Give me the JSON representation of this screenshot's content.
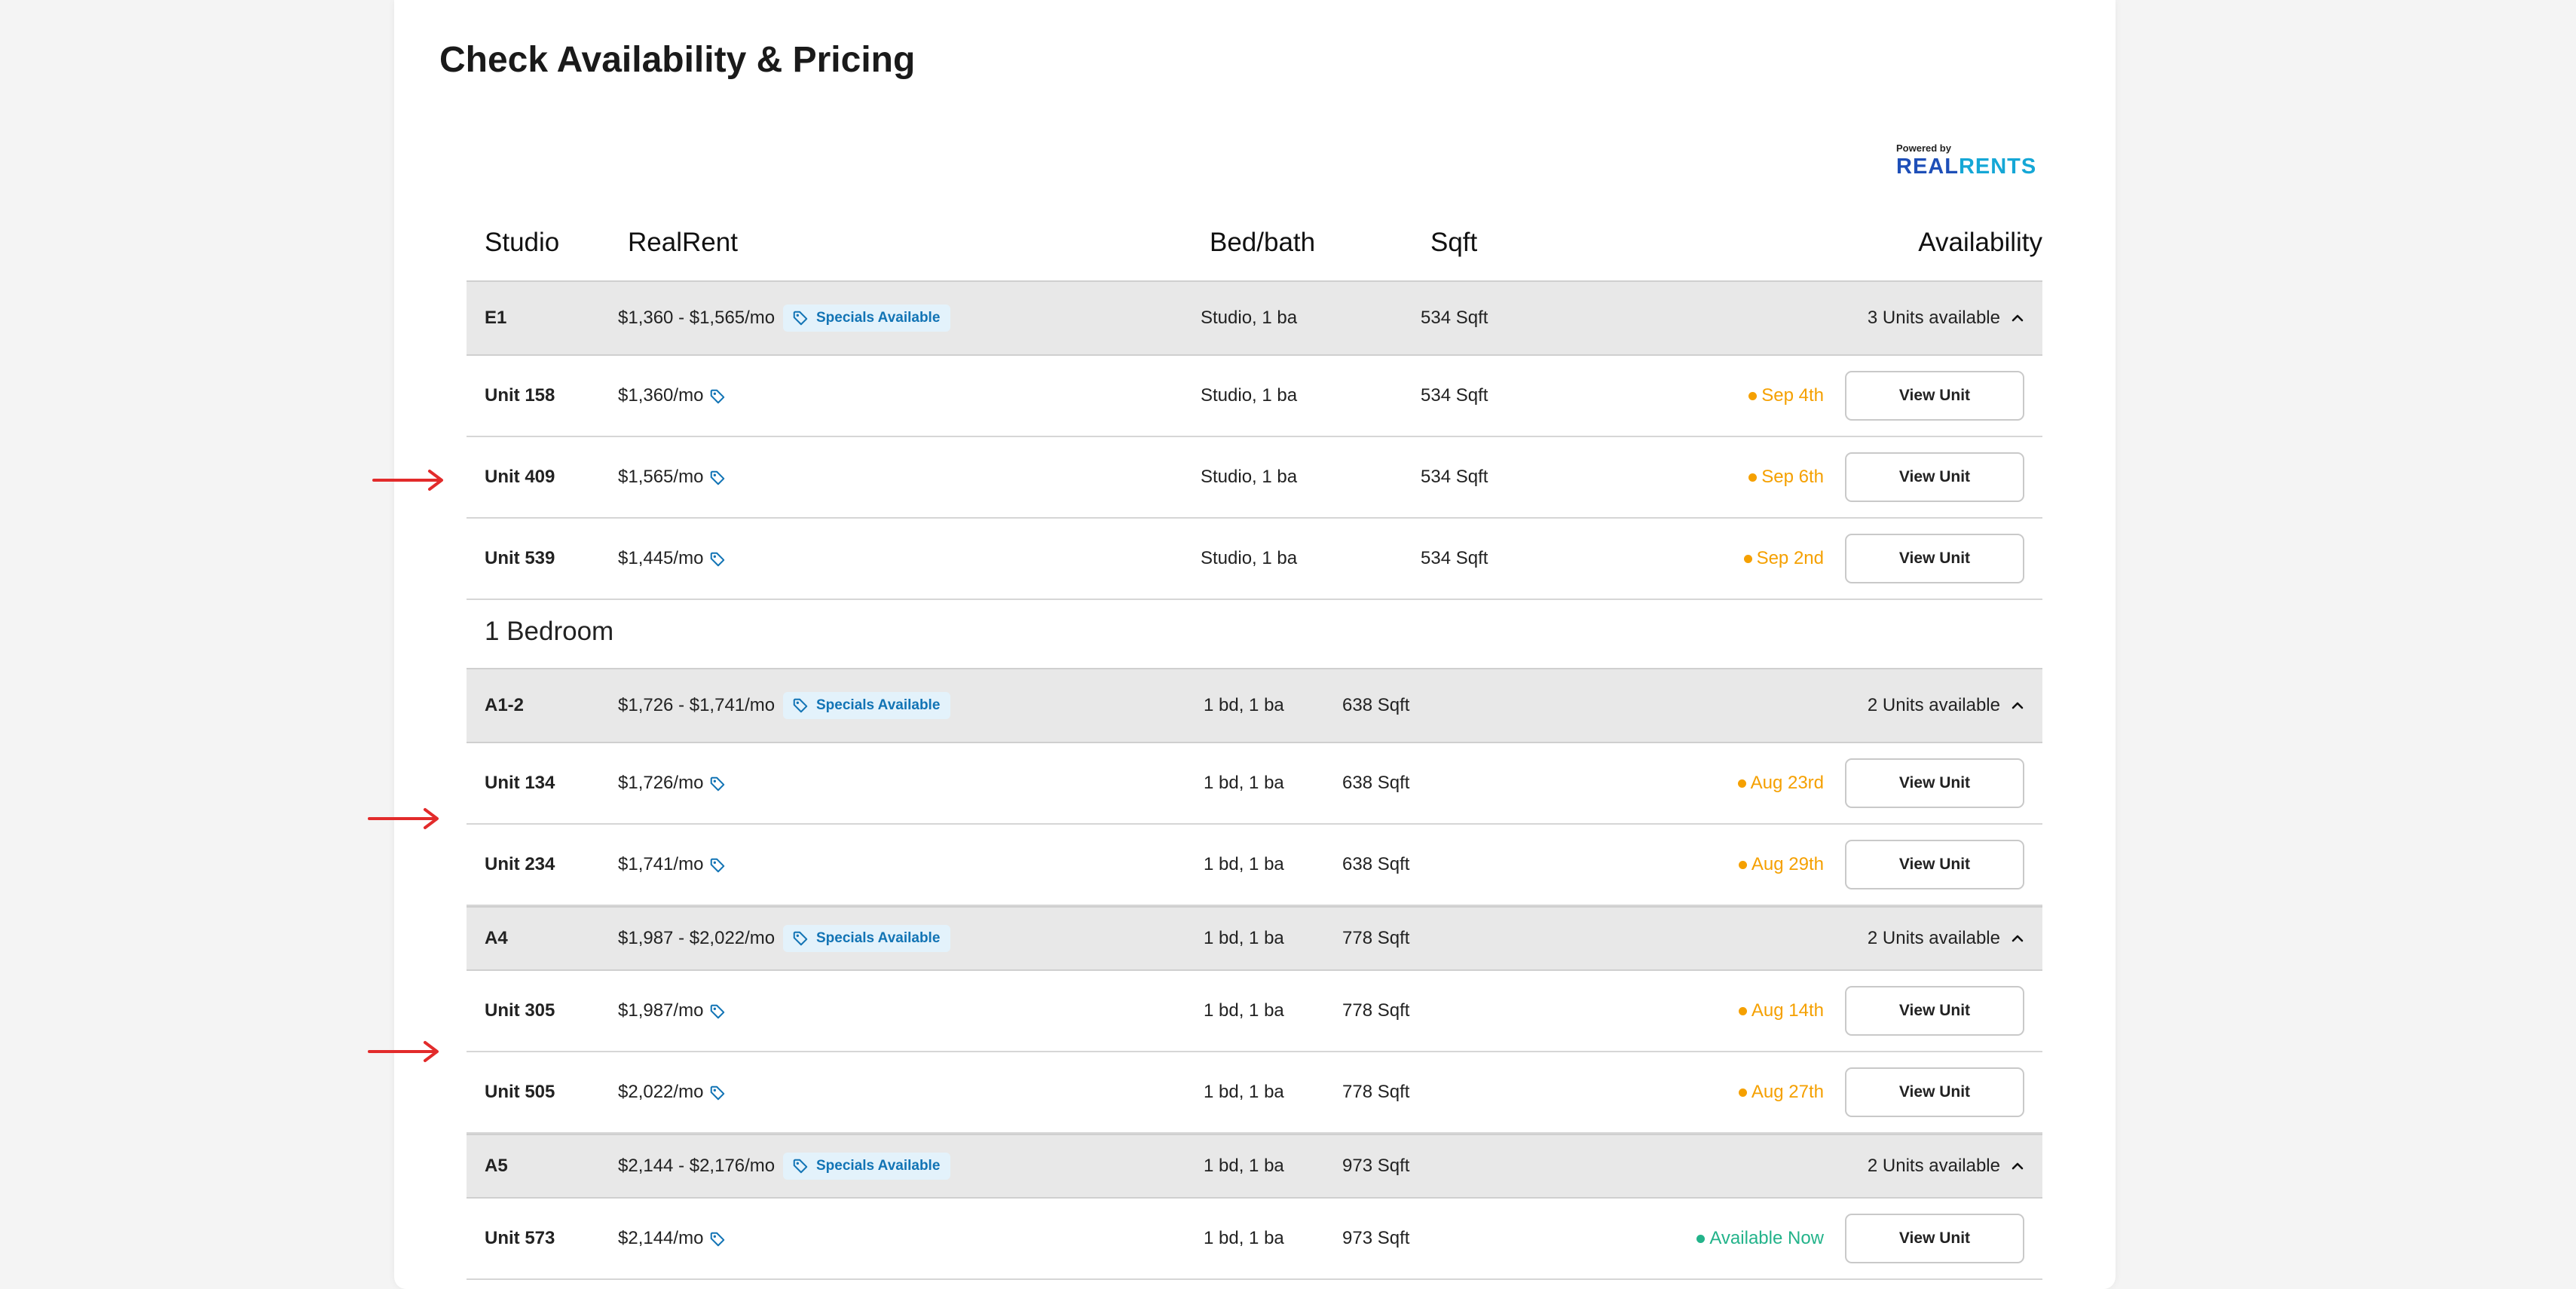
{
  "page": {
    "title": "Check Availability & Pricing"
  },
  "logo": {
    "powered_by": "Powered by",
    "word_a": "REAL",
    "word_b": "RENTS"
  },
  "colors": {
    "pending": "#f5a000",
    "available": "#23b38a",
    "specials_bg": "#e3f2fb",
    "specials_text": "#1274b5",
    "arrow": "#e22b2b"
  },
  "table": {
    "headers": {
      "category": "Studio",
      "rent": "RealRent",
      "bedbath": "Bed/bath",
      "sqft": "Sqft",
      "availability": "Availability"
    },
    "studio_groups": [
      {
        "name": "E1",
        "rent": "$1,360 - $1,565/mo",
        "specials": "Specials Available",
        "bedbath": "Studio, 1 ba",
        "sqft": "534 Sqft",
        "units_available": "3 Units available",
        "units": [
          {
            "name": "Unit 158",
            "rent": "$1,360/mo",
            "bedbath": "Studio, 1 ba",
            "sqft": "534 Sqft",
            "availability": "Sep 4th",
            "button": "View Unit"
          },
          {
            "name": "Unit 409",
            "rent": "$1,565/mo",
            "bedbath": "Studio, 1 ba",
            "sqft": "534 Sqft",
            "availability": "Sep 6th",
            "button": "View Unit"
          },
          {
            "name": "Unit 539",
            "rent": "$1,445/mo",
            "bedbath": "Studio, 1 ba",
            "sqft": "534 Sqft",
            "availability": "Sep 2nd",
            "button": "View Unit"
          }
        ]
      }
    ],
    "one_bedroom": {
      "label": "1 Bedroom",
      "groups": [
        {
          "name": "A1-2",
          "rent": "$1,726 - $1,741/mo",
          "specials": "Specials Available",
          "bedbath": "1 bd, 1 ba",
          "sqft": "638 Sqft",
          "units_available": "2 Units available",
          "units": [
            {
              "name": "Unit 134",
              "rent": "$1,726/mo",
              "bedbath": "1 bd, 1 ba",
              "sqft": "638 Sqft",
              "availability": "Aug 23rd",
              "button": "View Unit"
            },
            {
              "name": "Unit 234",
              "rent": "$1,741/mo",
              "bedbath": "1 bd, 1 ba",
              "sqft": "638 Sqft",
              "availability": "Aug 29th",
              "button": "View Unit"
            }
          ]
        },
        {
          "name": "A4",
          "rent": "$1,987 - $2,022/mo",
          "specials": "Specials Available",
          "bedbath": "1 bd, 1 ba",
          "sqft": "778 Sqft",
          "units_available": "2 Units available",
          "units": [
            {
              "name": "Unit 305",
              "rent": "$1,987/mo",
              "bedbath": "1 bd, 1 ba",
              "sqft": "778 Sqft",
              "availability": "Aug 14th",
              "button": "View Unit"
            },
            {
              "name": "Unit 505",
              "rent": "$2,022/mo",
              "bedbath": "1 bd, 1 ba",
              "sqft": "778 Sqft",
              "availability": "Aug 27th",
              "button": "View Unit"
            }
          ]
        },
        {
          "name": "A5",
          "rent": "$2,144 - $2,176/mo",
          "specials": "Specials Available",
          "bedbath": "1 bd, 1 ba",
          "sqft": "973 Sqft",
          "units_available": "2 Units available",
          "units": [
            {
              "name": "Unit 573",
              "rent": "$2,144/mo",
              "bedbath": "1 bd, 1 ba",
              "sqft": "973 Sqft",
              "availability": "Available Now",
              "button": "View Unit"
            }
          ]
        }
      ]
    }
  }
}
